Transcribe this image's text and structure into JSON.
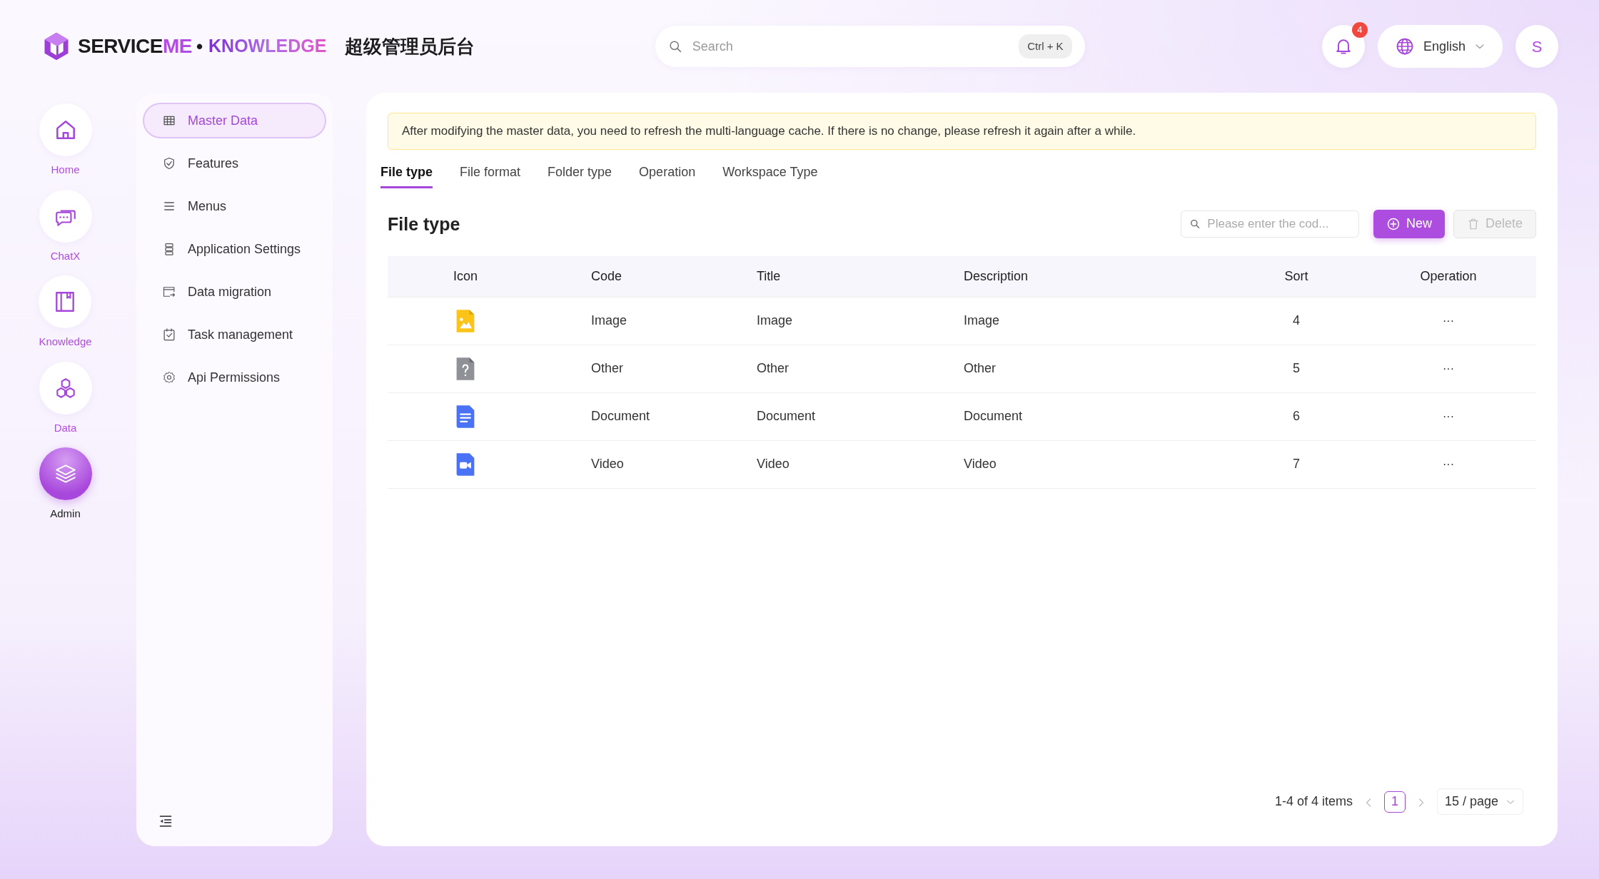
{
  "header": {
    "brand_dark": "SERVICE",
    "brand_accent": "ME",
    "separator": "•",
    "product": "KNOWLEDGE",
    "admin_title": "超级管理员后台",
    "search": {
      "placeholder": "Search",
      "shortcut": "Ctrl + K"
    },
    "notifications": {
      "count": "4"
    },
    "language": {
      "label": "English"
    },
    "avatar": {
      "initial": "S"
    }
  },
  "rail": [
    {
      "label": "Home",
      "kind": "home",
      "selected": false
    },
    {
      "label": "ChatX",
      "kind": "chat",
      "selected": false
    },
    {
      "label": "Knowledge",
      "kind": "book",
      "selected": false
    },
    {
      "label": "Data",
      "kind": "hexagons",
      "selected": false
    },
    {
      "label": "Admin",
      "kind": "layers",
      "selected": true
    }
  ],
  "sidebar": {
    "items": [
      {
        "label": "Master Data",
        "kind": "grid",
        "selected": true
      },
      {
        "label": "Features",
        "kind": "shield",
        "selected": false
      },
      {
        "label": "Menus",
        "kind": "list",
        "selected": false
      },
      {
        "label": "Application Settings",
        "kind": "server",
        "selected": false
      },
      {
        "label": "Data migration",
        "kind": "window",
        "selected": false
      },
      {
        "label": "Task management",
        "kind": "task",
        "selected": false
      },
      {
        "label": "Api Permissions",
        "kind": "gear",
        "selected": false
      }
    ]
  },
  "notice": "After modifying the master data, you need to refresh the multi-language cache. If there is no change, please refresh it again after a while.",
  "tabs": [
    {
      "label": "File type",
      "selected": true
    },
    {
      "label": "File format",
      "selected": false
    },
    {
      "label": "Folder type",
      "selected": false
    },
    {
      "label": "Operation",
      "selected": false
    },
    {
      "label": "Workspace Type",
      "selected": false
    }
  ],
  "section_title": "File type",
  "filter": {
    "placeholder": "Please enter the cod..."
  },
  "buttons": [
    {
      "label": "New",
      "kind": "new",
      "disabled": false
    },
    {
      "label": "Delete",
      "kind": "delete",
      "disabled": true
    }
  ],
  "table": {
    "columns": [
      "Icon",
      "Code",
      "Title",
      "Description",
      "Sort",
      "Operation"
    ],
    "rows": [
      {
        "kind": "image",
        "code": "Image",
        "title": "Image",
        "description": "Image",
        "sort": "4",
        "operation": "···"
      },
      {
        "kind": "other",
        "code": "Other",
        "title": "Other",
        "description": "Other",
        "sort": "5",
        "operation": "···"
      },
      {
        "kind": "document",
        "code": "Document",
        "title": "Document",
        "description": "Document",
        "sort": "6",
        "operation": "···"
      },
      {
        "kind": "video",
        "code": "Video",
        "title": "Video",
        "description": "Video",
        "sort": "7",
        "operation": "···"
      }
    ]
  },
  "pagination": {
    "summary": "1-4 of 4 items",
    "pages": [
      {
        "label": "1",
        "selected": true
      }
    ],
    "page_size": "15 / page"
  }
}
